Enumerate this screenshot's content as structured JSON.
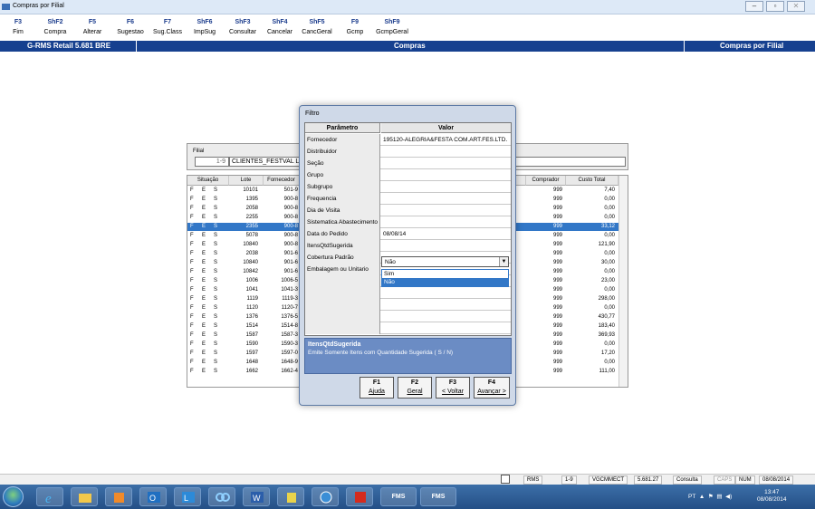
{
  "window": {
    "title": "Compras por Filial",
    "btn_min": "‒",
    "btn_max": "▫",
    "btn_close": "✕"
  },
  "fkeys": [
    {
      "key": "F3",
      "label": "Fim"
    },
    {
      "key": "ShF2",
      "label": "Compra"
    },
    {
      "key": "F5",
      "label": "Alterar"
    },
    {
      "key": "F6",
      "label": "Sugestao"
    },
    {
      "key": "F7",
      "label": "Sug.Class"
    },
    {
      "key": "ShF6",
      "label": "ImpSug"
    },
    {
      "key": "ShF3",
      "label": "Consultar"
    },
    {
      "key": "ShF4",
      "label": "Cancelar"
    },
    {
      "key": "ShF5",
      "label": "CancGeral"
    },
    {
      "key": "F9",
      "label": "Gcmp"
    },
    {
      "key": "ShF9",
      "label": "GcmpGeral"
    }
  ],
  "header": {
    "left": "G-RMS Retail 5.681 BRE",
    "center": "Compras",
    "right": "Compras por Filial"
  },
  "filial": {
    "label": "Filial",
    "code": "1-9",
    "name": "CLIENTES_FESTVAL L"
  },
  "grid": {
    "headers": {
      "situacao": "Situação",
      "lote": "Lote",
      "fornecedor": "Fornecedor",
      "comprador": "Comprador",
      "custo": "Custo Total"
    },
    "rows": [
      {
        "s1": "F",
        "s2": "E",
        "s3": "S",
        "lote": "10101",
        "forn": "501-9",
        "comp": "999",
        "custo": "7,40"
      },
      {
        "s1": "F",
        "s2": "E",
        "s3": "S",
        "lote": "1395",
        "forn": "900-8",
        "comp": "999",
        "custo": "0,00"
      },
      {
        "s1": "F",
        "s2": "E",
        "s3": "S",
        "lote": "2058",
        "forn": "900-8",
        "comp": "999",
        "custo": "0,00"
      },
      {
        "s1": "F",
        "s2": "E",
        "s3": "S",
        "lote": "2255",
        "forn": "900-8",
        "comp": "999",
        "custo": "0,00"
      },
      {
        "s1": "F",
        "s2": "E",
        "s3": "S",
        "lote": "2355",
        "forn": "900-8",
        "comp": "999",
        "custo": "33,12"
      },
      {
        "s1": "F",
        "s2": "E",
        "s3": "S",
        "lote": "5078",
        "forn": "900-8",
        "comp": "999",
        "custo": "0,00"
      },
      {
        "s1": "F",
        "s2": "E",
        "s3": "S",
        "lote": "10840",
        "forn": "900-8",
        "comp": "999",
        "custo": "121,90"
      },
      {
        "s1": "F",
        "s2": "E",
        "s3": "S",
        "lote": "2038",
        "forn": "901-6",
        "comp": "999",
        "custo": "0,00"
      },
      {
        "s1": "F",
        "s2": "E",
        "s3": "S",
        "lote": "10840",
        "forn": "901-6",
        "comp": "999",
        "custo": "30,00"
      },
      {
        "s1": "F",
        "s2": "E",
        "s3": "S",
        "lote": "10842",
        "forn": "901-6",
        "comp": "999",
        "custo": "0,00"
      },
      {
        "s1": "F",
        "s2": "E",
        "s3": "S",
        "lote": "1006",
        "forn": "1006-5",
        "comp": "999",
        "custo": "23,00"
      },
      {
        "s1": "F",
        "s2": "E",
        "s3": "S",
        "lote": "1041",
        "forn": "1041-3",
        "comp": "999",
        "custo": "0,00"
      },
      {
        "s1": "F",
        "s2": "E",
        "s3": "S",
        "lote": "1119",
        "forn": "1119-3",
        "comp": "999",
        "custo": "298,00"
      },
      {
        "s1": "F",
        "s2": "E",
        "s3": "S",
        "lote": "1120",
        "forn": "1120-7",
        "comp": "999",
        "custo": "0,00"
      },
      {
        "s1": "F",
        "s2": "E",
        "s3": "S",
        "lote": "1376",
        "forn": "1376-5",
        "comp": "999",
        "custo": "430,77"
      },
      {
        "s1": "F",
        "s2": "E",
        "s3": "S",
        "lote": "1514",
        "forn": "1514-8",
        "comp": "999",
        "custo": "183,40"
      },
      {
        "s1": "F",
        "s2": "E",
        "s3": "S",
        "lote": "1587",
        "forn": "1587-3",
        "comp": "999",
        "custo": "369,93"
      },
      {
        "s1": "F",
        "s2": "E",
        "s3": "S",
        "lote": "1590",
        "forn": "1590-3",
        "comp": "999",
        "custo": "0,00"
      },
      {
        "s1": "F",
        "s2": "E",
        "s3": "S",
        "lote": "1597",
        "forn": "1597-0",
        "comp": "999",
        "custo": "17,20"
      },
      {
        "s1": "F",
        "s2": "E",
        "s3": "S",
        "lote": "1648",
        "forn": "1648-9",
        "comp": "999",
        "custo": "0,00"
      },
      {
        "s1": "F",
        "s2": "E",
        "s3": "S",
        "lote": "1662",
        "forn": "1662-4",
        "comp": "999",
        "custo": "111,00"
      }
    ]
  },
  "dialog": {
    "title": "Filtro",
    "col_param": "Parâmetro",
    "col_valor": "Valor",
    "params": [
      {
        "name": "Fornecedor",
        "value": "195120-ALEGRIA&FESTA COM.ART.FES.LTD."
      },
      {
        "name": "Distribuidor",
        "value": ""
      },
      {
        "name": "Seção",
        "value": ""
      },
      {
        "name": "Grupo",
        "value": ""
      },
      {
        "name": "Subgrupo",
        "value": ""
      },
      {
        "name": "Frequencia",
        "value": ""
      },
      {
        "name": "Dia de Visita",
        "value": ""
      },
      {
        "name": "Sistematica Abastecimento",
        "value": ""
      },
      {
        "name": "Data do Pedido",
        "value": "08/08/14"
      },
      {
        "name": "ItensQtdSugerida",
        "value": ""
      },
      {
        "name": "Cobertura Padrão",
        "value": ""
      },
      {
        "name": "Embalagem ou Unitario",
        "value": ""
      },
      {
        "name": "",
        "value": ""
      },
      {
        "name": "",
        "value": ""
      },
      {
        "name": "",
        "value": ""
      },
      {
        "name": "",
        "value": ""
      },
      {
        "name": "",
        "value": ""
      }
    ],
    "combo_value": "Não",
    "options": [
      "Sim",
      "Não"
    ],
    "desc_title": "ItensQtdSugerida",
    "desc_text": "Emite Somente Itens com Quantidade Sugerida ( S / N)",
    "buttons": [
      {
        "key": "F1",
        "label": "Ajuda"
      },
      {
        "key": "F2",
        "label": "Geral"
      },
      {
        "key": "F3",
        "label": "< Voltar"
      },
      {
        "key": "F4",
        "label": "Avançar >"
      }
    ]
  },
  "status": {
    "rms": "RMS",
    "filial": "1-9",
    "user": "VGCMMECT",
    "version": "5.681.27",
    "mode": "Consulta",
    "caps": "CAPS",
    "num": "NUM",
    "date": "08/08/2014"
  },
  "taskbar": {
    "lang": "PT",
    "time": "13:47",
    "date": "08/08/2014",
    "fms1": "FMS",
    "fms2": "FMS"
  }
}
